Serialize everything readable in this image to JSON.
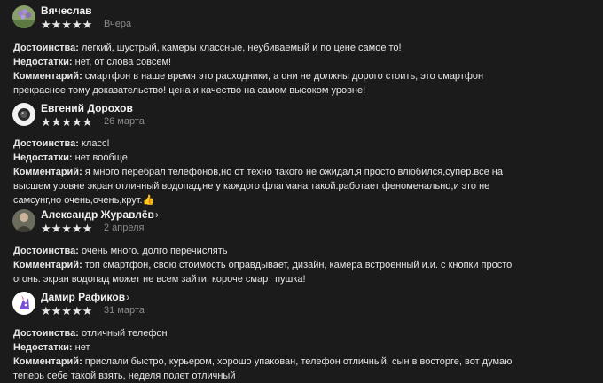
{
  "reviews": [
    {
      "author": "Вячеслав",
      "chevron": "",
      "stars": "★★★★★",
      "date": "Вчера",
      "avatar_icon": "lavender-flower-icon",
      "pros_label": "Достоинства:",
      "pros_text": " легкий, шустрый, камеры классные, неубиваемый и по цене самое то!",
      "cons_label": "Недостатки:",
      "cons_text": " нет, от слова совсем!",
      "comment_label": "Комментарий:",
      "comment_lines": [
        " смартфон в наше время это расходники, а они не должны дорого стоить, это смартфон",
        "прекрасное тому доказательство! цена и качество на самом высоком уровне!"
      ]
    },
    {
      "author": "Евгений Дорохов",
      "chevron": "",
      "stars": "★★★★★",
      "date": "26 марта",
      "avatar_icon": "camera-lens-icon",
      "pros_label": "Достоинства:",
      "pros_text": " класс!",
      "cons_label": "Недостатки:",
      "cons_text": " нет вообще",
      "comment_label": "Комментарий:",
      "comment_lines": [
        " я много перебрал телефонов,но от техно такого не ожидал,я просто влюбился,супер.все на",
        "высшем уровне экран отличный водопад,не у каждого флагмана такой.работает феноменально,и это не",
        "самсунг,но очень,очень,крут.👍"
      ]
    },
    {
      "author": "Александр Журавлёв",
      "chevron": "›",
      "stars": "★★★★★",
      "date": "2 апреля",
      "avatar_icon": "person-photo-icon",
      "pros_label": "Достоинства:",
      "pros_text": " очень много. долго перечислять",
      "comment_label": "Комментарий:",
      "comment_lines": [
        " топ смартфон, свою стоимость оправдывает, дизайн, камера встроенный и.и. с кнопки просто",
        "огонь. экран водопад может не всем зайти, короче смарт пушка!"
      ]
    },
    {
      "author": "Дамир Рафиков",
      "chevron": "›",
      "stars": "★★★★★",
      "date": "31 марта",
      "avatar_icon": "unicorn-icon",
      "pros_label": "Достоинства:",
      "pros_text": " отличный телефон",
      "cons_label": "Недостатки:",
      "cons_text": " нет",
      "comment_label": "Комментарий:",
      "comment_lines": [
        " прислали быстро, курьером, хорошо упакован, телефон отличный, сын в восторге, вот думаю",
        "теперь себе такой взять, неделя полет отличный"
      ]
    }
  ]
}
